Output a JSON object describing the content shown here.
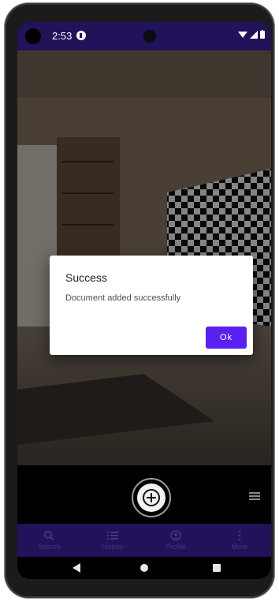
{
  "status_bar": {
    "time": "2:53",
    "icons": [
      "app-notification-icon",
      "wifi-icon",
      "signal-icon",
      "battery-icon"
    ]
  },
  "dialog": {
    "title": "Success",
    "message": "Document added successfully",
    "ok_label": "Ok"
  },
  "capture": {
    "icon": "plus-icon"
  },
  "bottom_nav": [
    {
      "label": "Search",
      "icon": "search-icon"
    },
    {
      "label": "History",
      "icon": "history-list-icon"
    },
    {
      "label": "Profile",
      "icon": "profile-icon"
    },
    {
      "label": "More",
      "icon": "more-vertical-icon"
    }
  ],
  "colors": {
    "accent": "#5b1ff2",
    "nav_bar": "#22125a",
    "nav_inactive": "#41358a"
  }
}
